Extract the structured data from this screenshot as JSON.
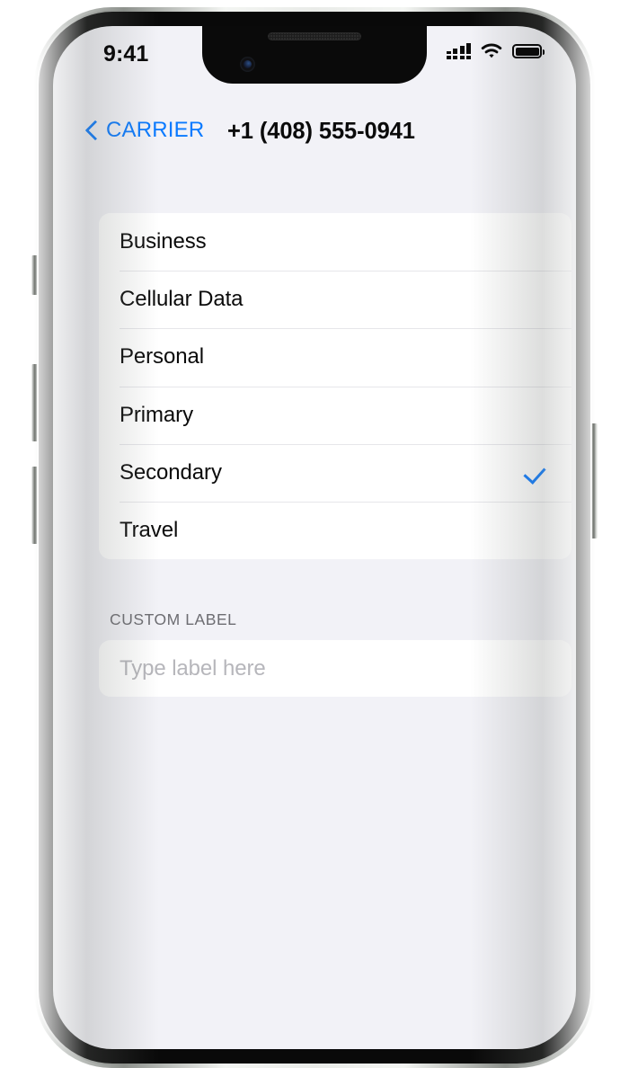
{
  "status_bar": {
    "time": "9:41",
    "signal_icon": "cellular-signal-icon",
    "signal_bars": 4,
    "wifi_icon": "wifi-icon",
    "battery_icon": "battery-full-icon"
  },
  "nav_bar": {
    "back_icon": "chevron-left-icon",
    "back_label": "CARRIER",
    "title": "+1 (408) 555-0941",
    "accent_color": "#0a7aff"
  },
  "label_list": {
    "rows": [
      {
        "label": "Business",
        "selected": false
      },
      {
        "label": "Cellular Data",
        "selected": false
      },
      {
        "label": "Personal",
        "selected": false
      },
      {
        "label": "Primary",
        "selected": false
      },
      {
        "label": "Secondary",
        "selected": true
      },
      {
        "label": "Travel",
        "selected": false
      }
    ],
    "checkmark_icon": "checkmark-icon",
    "checkmark_color": "#0a7aff"
  },
  "custom_label": {
    "header": "CUSTOM LABEL",
    "placeholder": "Type label here",
    "value": ""
  },
  "theme": {
    "background": "#f2f2f7",
    "card_background": "#ffffff",
    "separator": "#e6e6ea",
    "primary_text": "#0b0b0b",
    "secondary_text": "#6d6d72",
    "placeholder_text": "#b6b6bb"
  },
  "device": {
    "mute_switch": "mute-switch",
    "volume_up": "volume-up-button",
    "volume_down": "volume-down-button",
    "power": "power-button"
  }
}
